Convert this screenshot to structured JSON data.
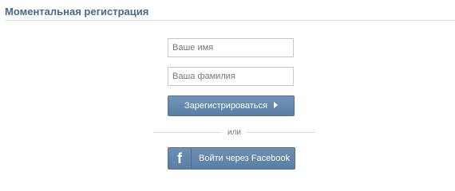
{
  "header": {
    "title": "Моментальная регистрация"
  },
  "form": {
    "first_name_placeholder": "Ваше имя",
    "last_name_placeholder": "Ваша фамилия",
    "register_label": "Зарегистрироваться",
    "divider_text": "или",
    "facebook_icon_glyph": "f",
    "facebook_label": "Войти через Facebook"
  },
  "icons": {
    "register_arrow": "arrow-right-icon",
    "facebook": "facebook-icon"
  },
  "colors": {
    "title": "#45688e",
    "button": "#5f82a9",
    "divider": "#dcdcdc"
  }
}
